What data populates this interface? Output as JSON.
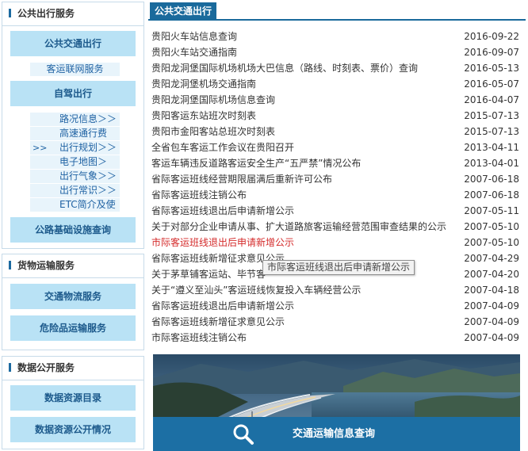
{
  "sidebar": {
    "public_travel": {
      "title": "公共出行服务",
      "public_transport": "公共交通出行",
      "passenger_network": "客运联网服务",
      "self_drive": "自驾出行",
      "self_drive_items": [
        {
          "label": "路况信息＞＞",
          "arrow": ""
        },
        {
          "label": "高速通行费",
          "arrow": ""
        },
        {
          "label": "出行规划＞＞",
          "arrow": ">>"
        },
        {
          "label": "电子地图＞",
          "arrow": ""
        },
        {
          "label": "出行气象＞＞",
          "arrow": ""
        },
        {
          "label": "出行常识＞＞",
          "arrow": ""
        },
        {
          "label": "ETC简介及使",
          "arrow": ""
        }
      ],
      "road_infra": "公路基础设施查询"
    },
    "freight": {
      "title": "货物运输服务",
      "logistics": "交通物流服务",
      "hazmat": "危险品运输服务"
    },
    "open_data": {
      "title": "数据公开服务",
      "catalog": "数据资源目录",
      "open_status": "数据资源公开情况"
    }
  },
  "main": {
    "tab_title": "公共交通出行",
    "news": [
      {
        "title": "贵阳火车站信息查询",
        "date": "2016-09-22"
      },
      {
        "title": "贵阳火车站交通指南",
        "date": "2016-09-07"
      },
      {
        "title": "贵阳龙洞堡国际机场机场大巴信息（路线、时刻表、票价）查询",
        "date": "2016-05-13"
      },
      {
        "title": "贵阳龙洞堡机场交通指南",
        "date": "2016-05-07"
      },
      {
        "title": "贵阳龙洞堡国际机场信息查询",
        "date": "2016-04-07"
      },
      {
        "title": "贵阳客运东站班次时刻表",
        "date": "2015-07-13"
      },
      {
        "title": "贵阳市金阳客站总班次时刻表",
        "date": "2015-07-13"
      },
      {
        "title": "全省包车客运工作会议在贵阳召开",
        "date": "2013-04-11"
      },
      {
        "title": "客运车辆违反道路客运安全生产“五严禁”情况公布",
        "date": "2013-04-01"
      },
      {
        "title": "省际客运班线经营期限届满后重新许可公布",
        "date": "2007-06-18"
      },
      {
        "title": "省际客运班线注销公布",
        "date": "2007-06-18"
      },
      {
        "title": "省际客运班线退出后申请新增公示",
        "date": "2007-05-11"
      },
      {
        "title": "关于对部分企业申请从事、扩大道路旅客运输经营范围审查结果的公示",
        "date": "2007-05-10"
      },
      {
        "title": "市际客运班线退出后申请新增公示",
        "date": "2007-05-10"
      },
      {
        "title": "省际客运班线新增征求意见公示",
        "date": "2007-04-29"
      },
      {
        "title": "关于茅草铺客运站、毕节客",
        "date": "2007-04-20"
      },
      {
        "title": "关于“遵义至汕头”客运班线恢复投入车辆经营公示",
        "date": "2007-04-18"
      },
      {
        "title": "省际客运班线退出后申请新增公示",
        "date": "2007-04-09"
      },
      {
        "title": "省际客运班线新增征求意见公示",
        "date": "2007-04-09"
      },
      {
        "title": "市际客运班线注销公布",
        "date": "2007-04-09"
      }
    ],
    "tooltip": "市际客运班线退出后申请新增公示",
    "banner_label": "交通运输信息查询"
  },
  "colors": {
    "accent": "#1a6a9c",
    "button_bg": "#b9e2f5",
    "button_text": "#1d5a8c",
    "highlight_link": "#d42a2a"
  }
}
